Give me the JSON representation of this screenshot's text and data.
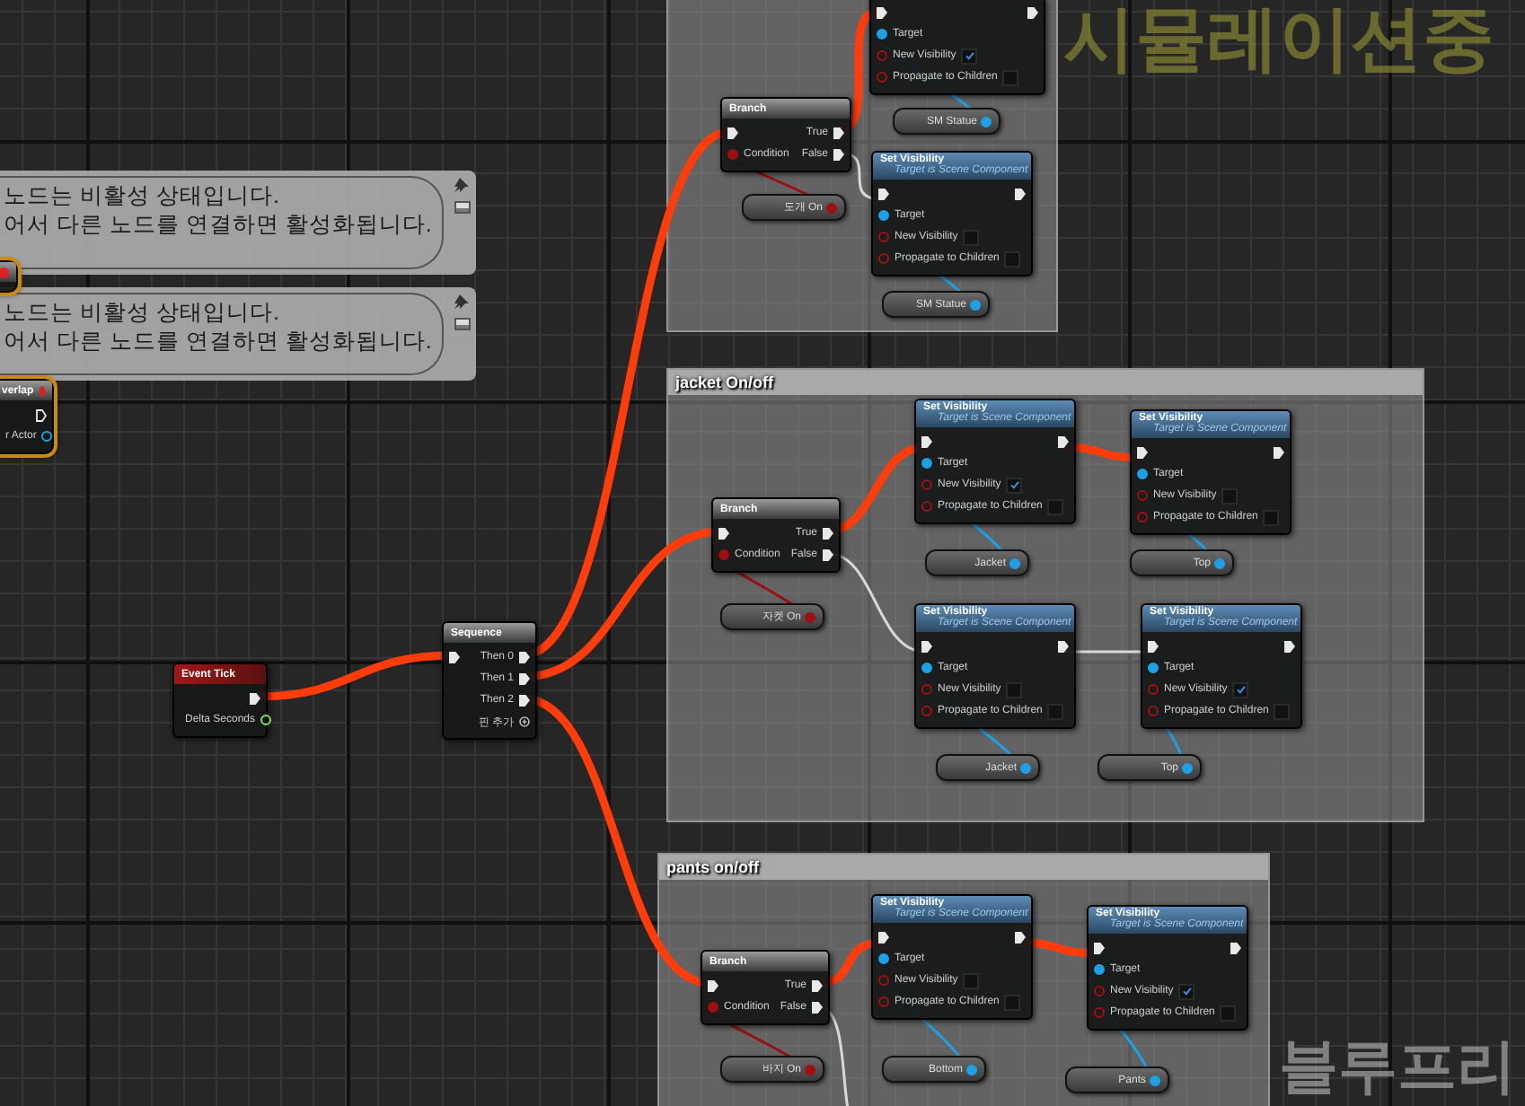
{
  "corner_labels": [
    {
      "kind": "simulating",
      "text": "시뮬레이션중"
    },
    {
      "kind": "blueprint",
      "text": "블루프리"
    }
  ],
  "comments": [
    {
      "lines": [
        "노드는 비활성 상태입니다.",
        "어서 다른 노드를 연결하면 활성화됩니다."
      ]
    },
    {
      "lines": [
        "노드는 비활성 상태입니다.",
        "어서 다른 노드를 연결하면 활성화됩니다."
      ]
    }
  ],
  "groups": [
    {
      "kind": "untitled"
    },
    {
      "kind": "titled",
      "title": "jacket On/off"
    },
    {
      "kind": "titled",
      "title": "pants on/off"
    }
  ],
  "nodes": [
    {
      "kind": "partial"
    },
    {
      "kind": "partial",
      "title": "verlap",
      "pins": [
        {
          "label": "r Actor",
          "kind": "object"
        }
      ]
    },
    {
      "kind": "event",
      "title": "Event Tick",
      "pins": [
        {
          "label": "Delta Seconds",
          "kind": "float"
        }
      ]
    },
    {
      "kind": "sequence",
      "title": "Sequence",
      "outputs": [
        "Then 0",
        "Then 1",
        "Then 2"
      ],
      "add_pin": "핀 추가"
    },
    {
      "kind": "set_visibility",
      "pins": [
        {
          "label": "Target",
          "kind": "object"
        },
        {
          "label": "New Visibility",
          "kind": "bool",
          "checked": true
        },
        {
          "label": "Propagate to Children",
          "kind": "bool",
          "checked": false
        }
      ]
    },
    {
      "kind": "variable",
      "label": "SM Statue",
      "pins": [
        {
          "kind": "object"
        }
      ]
    },
    {
      "kind": "branch",
      "title": "Branch",
      "condition": "Condition",
      "outputs": [
        "True",
        "False"
      ]
    },
    {
      "kind": "variable",
      "label": "도개 On",
      "pins": [
        {
          "kind": "bool"
        }
      ]
    },
    {
      "kind": "set_visibility",
      "title": "Set Visibility",
      "subtitle": "Target is Scene Component",
      "pins": [
        {
          "label": "Target",
          "kind": "object"
        },
        {
          "label": "New Visibility",
          "kind": "bool",
          "checked": false
        },
        {
          "label": "Propagate to Children",
          "kind": "bool",
          "checked": false
        }
      ]
    },
    {
      "kind": "variable",
      "label": "SM Statue",
      "pins": [
        {
          "kind": "object"
        }
      ]
    },
    {
      "kind": "branch",
      "title": "Branch",
      "condition": "Condition",
      "outputs": [
        "True",
        "False"
      ]
    },
    {
      "kind": "variable",
      "label": "자켓 On",
      "pins": [
        {
          "kind": "bool"
        }
      ]
    },
    {
      "kind": "set_visibility",
      "title": "Set Visibility",
      "subtitle": "Target is Scene Component",
      "pins": [
        {
          "label": "Target",
          "kind": "object"
        },
        {
          "label": "New Visibility",
          "kind": "bool",
          "checked": true
        },
        {
          "label": "Propagate to Children",
          "kind": "bool",
          "checked": false
        }
      ]
    },
    {
      "kind": "set_visibility",
      "title": "Set Visibility",
      "subtitle": "Target is Scene Component",
      "pins": [
        {
          "label": "Target",
          "kind": "object"
        },
        {
          "label": "New Visibility",
          "kind": "bool",
          "checked": false
        },
        {
          "label": "Propagate to Children",
          "kind": "bool",
          "checked": false
        }
      ]
    },
    {
      "kind": "variable",
      "label": "Jacket",
      "pins": [
        {
          "kind": "object"
        }
      ]
    },
    {
      "kind": "variable",
      "label": "Top",
      "pins": [
        {
          "kind": "object"
        }
      ]
    },
    {
      "kind": "set_visibility",
      "title": "Set Visibility",
      "subtitle": "Target is Scene Component",
      "pins": [
        {
          "label": "Target",
          "kind": "object"
        },
        {
          "label": "New Visibility",
          "kind": "bool",
          "checked": false
        },
        {
          "label": "Propagate to Children",
          "kind": "bool",
          "checked": false
        }
      ]
    },
    {
      "kind": "set_visibility",
      "title": "Set Visibility",
      "subtitle": "Target is Scene Component",
      "pins": [
        {
          "label": "Target",
          "kind": "object"
        },
        {
          "label": "New Visibility",
          "kind": "bool",
          "checked": true
        },
        {
          "label": "Propagate to Children",
          "kind": "bool",
          "checked": false
        }
      ]
    },
    {
      "kind": "variable",
      "label": "Jacket",
      "pins": [
        {
          "kind": "object"
        }
      ]
    },
    {
      "kind": "variable",
      "label": "Top",
      "pins": [
        {
          "kind": "object"
        }
      ]
    },
    {
      "kind": "branch",
      "title": "Branch",
      "condition": "Condition",
      "outputs": [
        "True",
        "False"
      ]
    },
    {
      "kind": "variable",
      "label": "바지 On",
      "pins": [
        {
          "kind": "bool"
        }
      ]
    },
    {
      "kind": "set_visibility",
      "title": "Set Visibility",
      "subtitle": "Target is Scene Component",
      "pins": [
        {
          "label": "Target",
          "kind": "object"
        },
        {
          "label": "New Visibility",
          "kind": "bool",
          "checked": false
        },
        {
          "label": "Propagate to Children",
          "kind": "bool",
          "checked": false
        }
      ]
    },
    {
      "kind": "set_visibility",
      "title": "Set Visibility",
      "subtitle": "Target is Scene Component",
      "pins": [
        {
          "label": "Target",
          "kind": "object"
        },
        {
          "label": "New Visibility",
          "kind": "bool",
          "checked": true
        },
        {
          "label": "Propagate to Children",
          "kind": "bool",
          "checked": false
        }
      ]
    },
    {
      "kind": "variable",
      "label": "Bottom",
      "pins": [
        {
          "kind": "object"
        }
      ]
    },
    {
      "kind": "variable",
      "label": "Pants",
      "pins": [
        {
          "kind": "object"
        }
      ]
    }
  ]
}
